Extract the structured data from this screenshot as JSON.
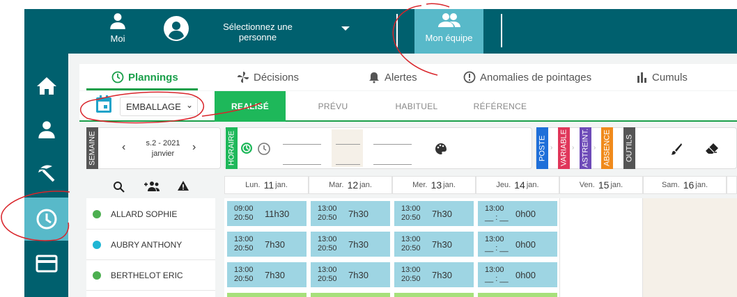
{
  "topbar": {
    "moi_label": "Moi",
    "person_select": "Sélectionnez une personne",
    "team_label": "Mon équipe"
  },
  "tabs": [
    {
      "label": "Plannings",
      "icon": "clock-icon",
      "active": true
    },
    {
      "label": "Décisions",
      "icon": "fan-icon"
    },
    {
      "label": "Alertes",
      "icon": "bell-icon"
    },
    {
      "label": "Anomalies de pointages",
      "icon": "exclamation-icon"
    },
    {
      "label": "Cumuls",
      "icon": "bar-chart-icon"
    }
  ],
  "filter": {
    "selected": "EMBALLAGE"
  },
  "subtabs": [
    "REALISÉ",
    "PRÉVU",
    "HABITUEL",
    "RÉFÉRENCE"
  ],
  "week": {
    "label": "SEMAINE",
    "line1": "s.2 - 2021",
    "line2": "janvier"
  },
  "toolbar": {
    "horaire": "HORAIRE",
    "poste": "POSTE",
    "variable": "VARIABLE",
    "astreinte": "ASTREINT.",
    "absence": "ABSENCE",
    "outils": "OUTILS"
  },
  "colors": {
    "primary": "#00606e",
    "accent": "#58b9c9",
    "green": "#1a9f4a",
    "poste": "#1e6fd9",
    "variable": "#e0365a",
    "astreinte": "#6e4bb8",
    "absence": "#f08a1c",
    "outils": "#555555"
  },
  "days": [
    {
      "dow": "Lun.",
      "num": "11",
      "month": "jan."
    },
    {
      "dow": "Mar.",
      "num": "12",
      "month": "jan."
    },
    {
      "dow": "Mer.",
      "num": "13",
      "month": "jan."
    },
    {
      "dow": "Jeu.",
      "num": "14",
      "month": "jan."
    },
    {
      "dow": "Ven.",
      "num": "15",
      "month": "jan."
    },
    {
      "dow": "Sam.",
      "num": "16",
      "month": "jan."
    }
  ],
  "employees": [
    {
      "name": "ALLARD SOPHIE",
      "dot": "#4caf50",
      "cells": [
        {
          "start": "09:00",
          "end": "20:50",
          "dur": "11h30"
        },
        {
          "start": "13:00",
          "end": "20:50",
          "dur": "7h30"
        },
        {
          "start": "13:00",
          "end": "20:50",
          "dur": "7h30"
        },
        {
          "start": "13:00",
          "end": "__ : __",
          "dur": "0h00"
        }
      ]
    },
    {
      "name": "AUBRY ANTHONY",
      "dot": "#1fb6d4",
      "cells": [
        {
          "start": "13:00",
          "end": "20:50",
          "dur": "7h30"
        },
        {
          "start": "13:00",
          "end": "20:50",
          "dur": "7h30"
        },
        {
          "start": "13:00",
          "end": "20:50",
          "dur": "7h30"
        },
        {
          "start": "13:00",
          "end": "__ : __",
          "dur": "0h00"
        }
      ]
    },
    {
      "name": "BERTHELOT ERIC",
      "dot": "#4caf50",
      "cells": [
        {
          "start": "13:00",
          "end": "20:50",
          "dur": "7h30"
        },
        {
          "start": "13:00",
          "end": "20:50",
          "dur": "7h30"
        },
        {
          "start": "13:00",
          "end": "20:50",
          "dur": "7h30"
        },
        {
          "start": "13:00",
          "end": "__ : __",
          "dur": "0h00"
        }
      ]
    }
  ]
}
